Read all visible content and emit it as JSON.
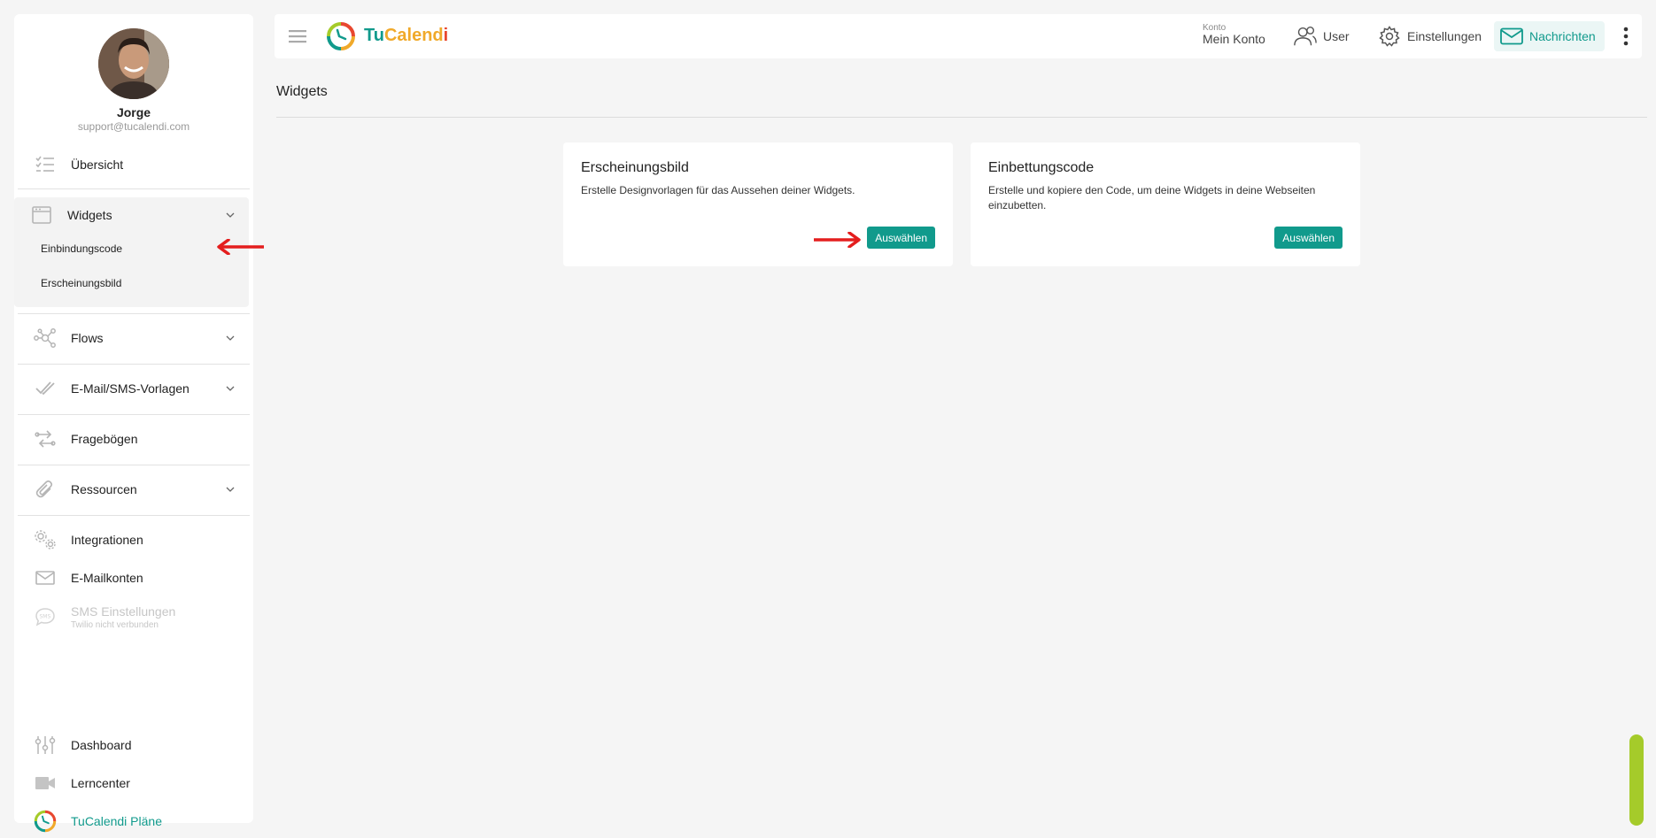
{
  "sidebar": {
    "user_name": "Jorge",
    "user_email": "support@tucalendi.com",
    "items": {
      "overview": "Übersicht",
      "widgets": "Widgets",
      "widgets_sub_embed": "Einbindungscode",
      "widgets_sub_appearance": "Erscheinungsbild",
      "flows": "Flows",
      "templates": "E-Mail/SMS-Vorlagen",
      "questionnaires": "Fragebögen",
      "resources": "Ressourcen",
      "integrations": "Integrationen",
      "email_accounts": "E-Mailkonten",
      "sms_settings": "SMS Einstellungen",
      "sms_status": "Twilio nicht verbunden",
      "dashboard": "Dashboard",
      "learning_center": "Lerncenter",
      "plans": "TuCalendi Pläne"
    }
  },
  "header": {
    "logo_part1": "Tu",
    "logo_part2": "Calend",
    "logo_part3": "i",
    "account_small": "Konto",
    "account_main": "Mein Konto",
    "user": "User",
    "settings": "Einstellungen",
    "messages": "Nachrichten"
  },
  "main": {
    "title": "Widgets",
    "cards": [
      {
        "title": "Erscheinungsbild",
        "description": "Erstelle Designvorlagen für das Aussehen deiner Widgets.",
        "button": "Auswählen"
      },
      {
        "title": "Einbettungscode",
        "description": "Erstelle und kopiere den Code, um deine Widgets in deine Webseiten einzubetten.",
        "button": "Auswählen"
      }
    ]
  },
  "colors": {
    "accent": "#119a8c",
    "annotation": "#e41e1e",
    "scroll_thumb": "#a5cb2a"
  },
  "icons": [
    "menu-icon",
    "users-icon",
    "gear-icon",
    "mail-icon",
    "kebab-icon",
    "checklist-icon",
    "browser-window-icon",
    "chevron-down-icon",
    "flow-nodes-icon",
    "double-check-icon",
    "swap-arrows-icon",
    "paperclip-icon",
    "gears-icon",
    "envelope-icon",
    "sms-bubble-icon",
    "sliders-icon",
    "video-camera-icon",
    "tucalendi-logo-icon"
  ]
}
